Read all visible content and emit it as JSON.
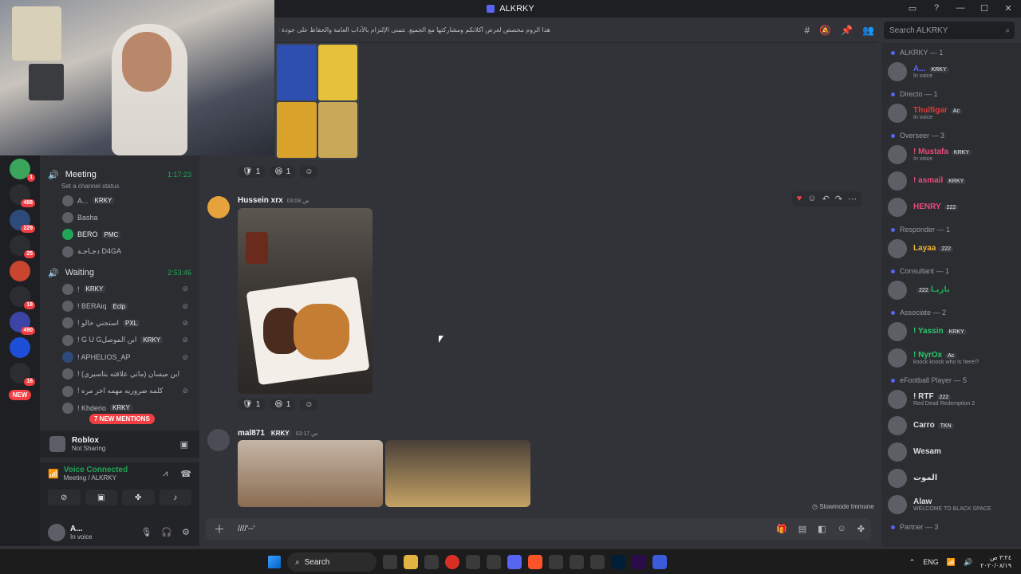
{
  "window": {
    "title": "ALKRKY"
  },
  "header": {
    "topic": "هذا الروم مخصص لعرض أكلاتكم ومشاركتها مع الجميع. نتمنى الإلتزام بالآداب العامة والحفاظ على جودة المحتوى.",
    "search_placeholder": "Search ALKRKY"
  },
  "sidebar": {
    "voice_channels": [
      {
        "name": "Meeting",
        "timer": "1:17:23",
        "status": "Set a channel status",
        "members": [
          {
            "name": "A...",
            "tag": "KRKY"
          },
          {
            "name": "Basha",
            "tag": ""
          },
          {
            "name": "BERO",
            "tag": "PMC"
          },
          {
            "name": "دجـاجـة D4GA",
            "tag": ""
          }
        ]
      },
      {
        "name": "Waiting",
        "timer": "2:53:46",
        "status": "",
        "members": [
          {
            "name": "!",
            "tag": "KRKY"
          },
          {
            "name": "! BERAiq",
            "tag": "Eclp"
          },
          {
            "name": "! استجني خالو",
            "tag": "PXL"
          },
          {
            "name": "! G U Gابن الموصل",
            "tag": "KRKY"
          },
          {
            "name": "! APHELIOS_AP",
            "tag": ""
          },
          {
            "name": "! ابن ميسان (ماتي علاقته بتاسيري)",
            "tag": ""
          },
          {
            "name": "! كلمه ضروريه مهمه اخر مره",
            "tag": ""
          },
          {
            "name": "! Khderio",
            "tag": "KRKY"
          }
        ]
      }
    ],
    "new_mentions": "7 NEW MENTIONS",
    "new_badge": "NEW",
    "server_badges": [
      "1",
      "488",
      "229",
      "25",
      "18",
      "490",
      "16"
    ]
  },
  "activity": {
    "name": "Roblox",
    "sub": "Not Sharing"
  },
  "voice": {
    "connected": "Voice Connected",
    "channel": "Meeting / ALKRKY"
  },
  "user": {
    "name": "A...",
    "status": "In voice"
  },
  "messages": {
    "reactions_a": [
      {
        "emoji": "🛡",
        "count": "1"
      },
      {
        "emoji": "😆",
        "count": "1"
      }
    ],
    "msg1": {
      "author": "Hussein xrx",
      "time": "03:08 ص"
    },
    "reactions_b": [
      {
        "emoji": "🛡",
        "count": "1"
      },
      {
        "emoji": "😆",
        "count": "1"
      }
    ],
    "msg2": {
      "author": "mal871",
      "tag": "KRKY",
      "time": "03:17 ص"
    }
  },
  "slowmode": "Slowmode Immune",
  "composer": {
    "text": "////'--'"
  },
  "members": {
    "groups": [
      {
        "role": "ALKRKY — 1",
        "items": [
          {
            "name": "A...",
            "tag": "KRKY",
            "status": "In voice",
            "color": "#5865f2"
          }
        ]
      },
      {
        "role": "Directo — 1",
        "items": [
          {
            "name": "Thulfigar",
            "tag": "Ac",
            "status": "In voice",
            "color": "#e03b3b"
          }
        ]
      },
      {
        "role": "Overseer — 3",
        "items": [
          {
            "name": "! Mustafa",
            "tag": "KRKY",
            "status": "In voice",
            "color": "#e84c7b"
          },
          {
            "name": "! asmail",
            "tag": "KRKY",
            "status": "",
            "color": "#e84c7b"
          },
          {
            "name": "HENRY",
            "tag": "222",
            "status": "",
            "color": "#e84c7b"
          }
        ]
      },
      {
        "role": "Responder — 1",
        "items": [
          {
            "name": "Layaa",
            "tag": "222",
            "status": "",
            "color": "#f0b232"
          }
        ]
      },
      {
        "role": "Consultant — 1",
        "items": [
          {
            "name": "باريـا",
            "tag": "222",
            "status": "",
            "color": "#23a559"
          }
        ]
      },
      {
        "role": "Associate — 2",
        "items": [
          {
            "name": "! Yassin",
            "tag": "KRKY",
            "status": "",
            "color": "#2dc770"
          },
          {
            "name": "! NyrOx",
            "tag": "Ac",
            "status": "knock knock who is here!?",
            "color": "#2dc770"
          }
        ]
      },
      {
        "role": "eFootball Player — 5",
        "items": [
          {
            "name": "! RTF",
            "tag": "222",
            "status": "Red Dead Redemption 2",
            "color": "#dbdee1"
          },
          {
            "name": "Carro",
            "tag": "TKN",
            "status": "",
            "color": "#dbdee1"
          },
          {
            "name": "Wesam",
            "tag": "",
            "status": "",
            "color": "#dbdee1"
          },
          {
            "name": "الموت",
            "tag": "",
            "status": "",
            "color": "#dbdee1"
          },
          {
            "name": "Alaw",
            "tag": "",
            "status": "WELCOME TO BLACK SPACE",
            "color": "#dbdee1"
          }
        ]
      },
      {
        "role": "Partner — 3",
        "items": []
      }
    ]
  },
  "taskbar": {
    "search": "Search",
    "lang": "ENG",
    "time": "٣:٢٤ ص",
    "date": "٢٠٢٠/٠٨/١٩"
  }
}
